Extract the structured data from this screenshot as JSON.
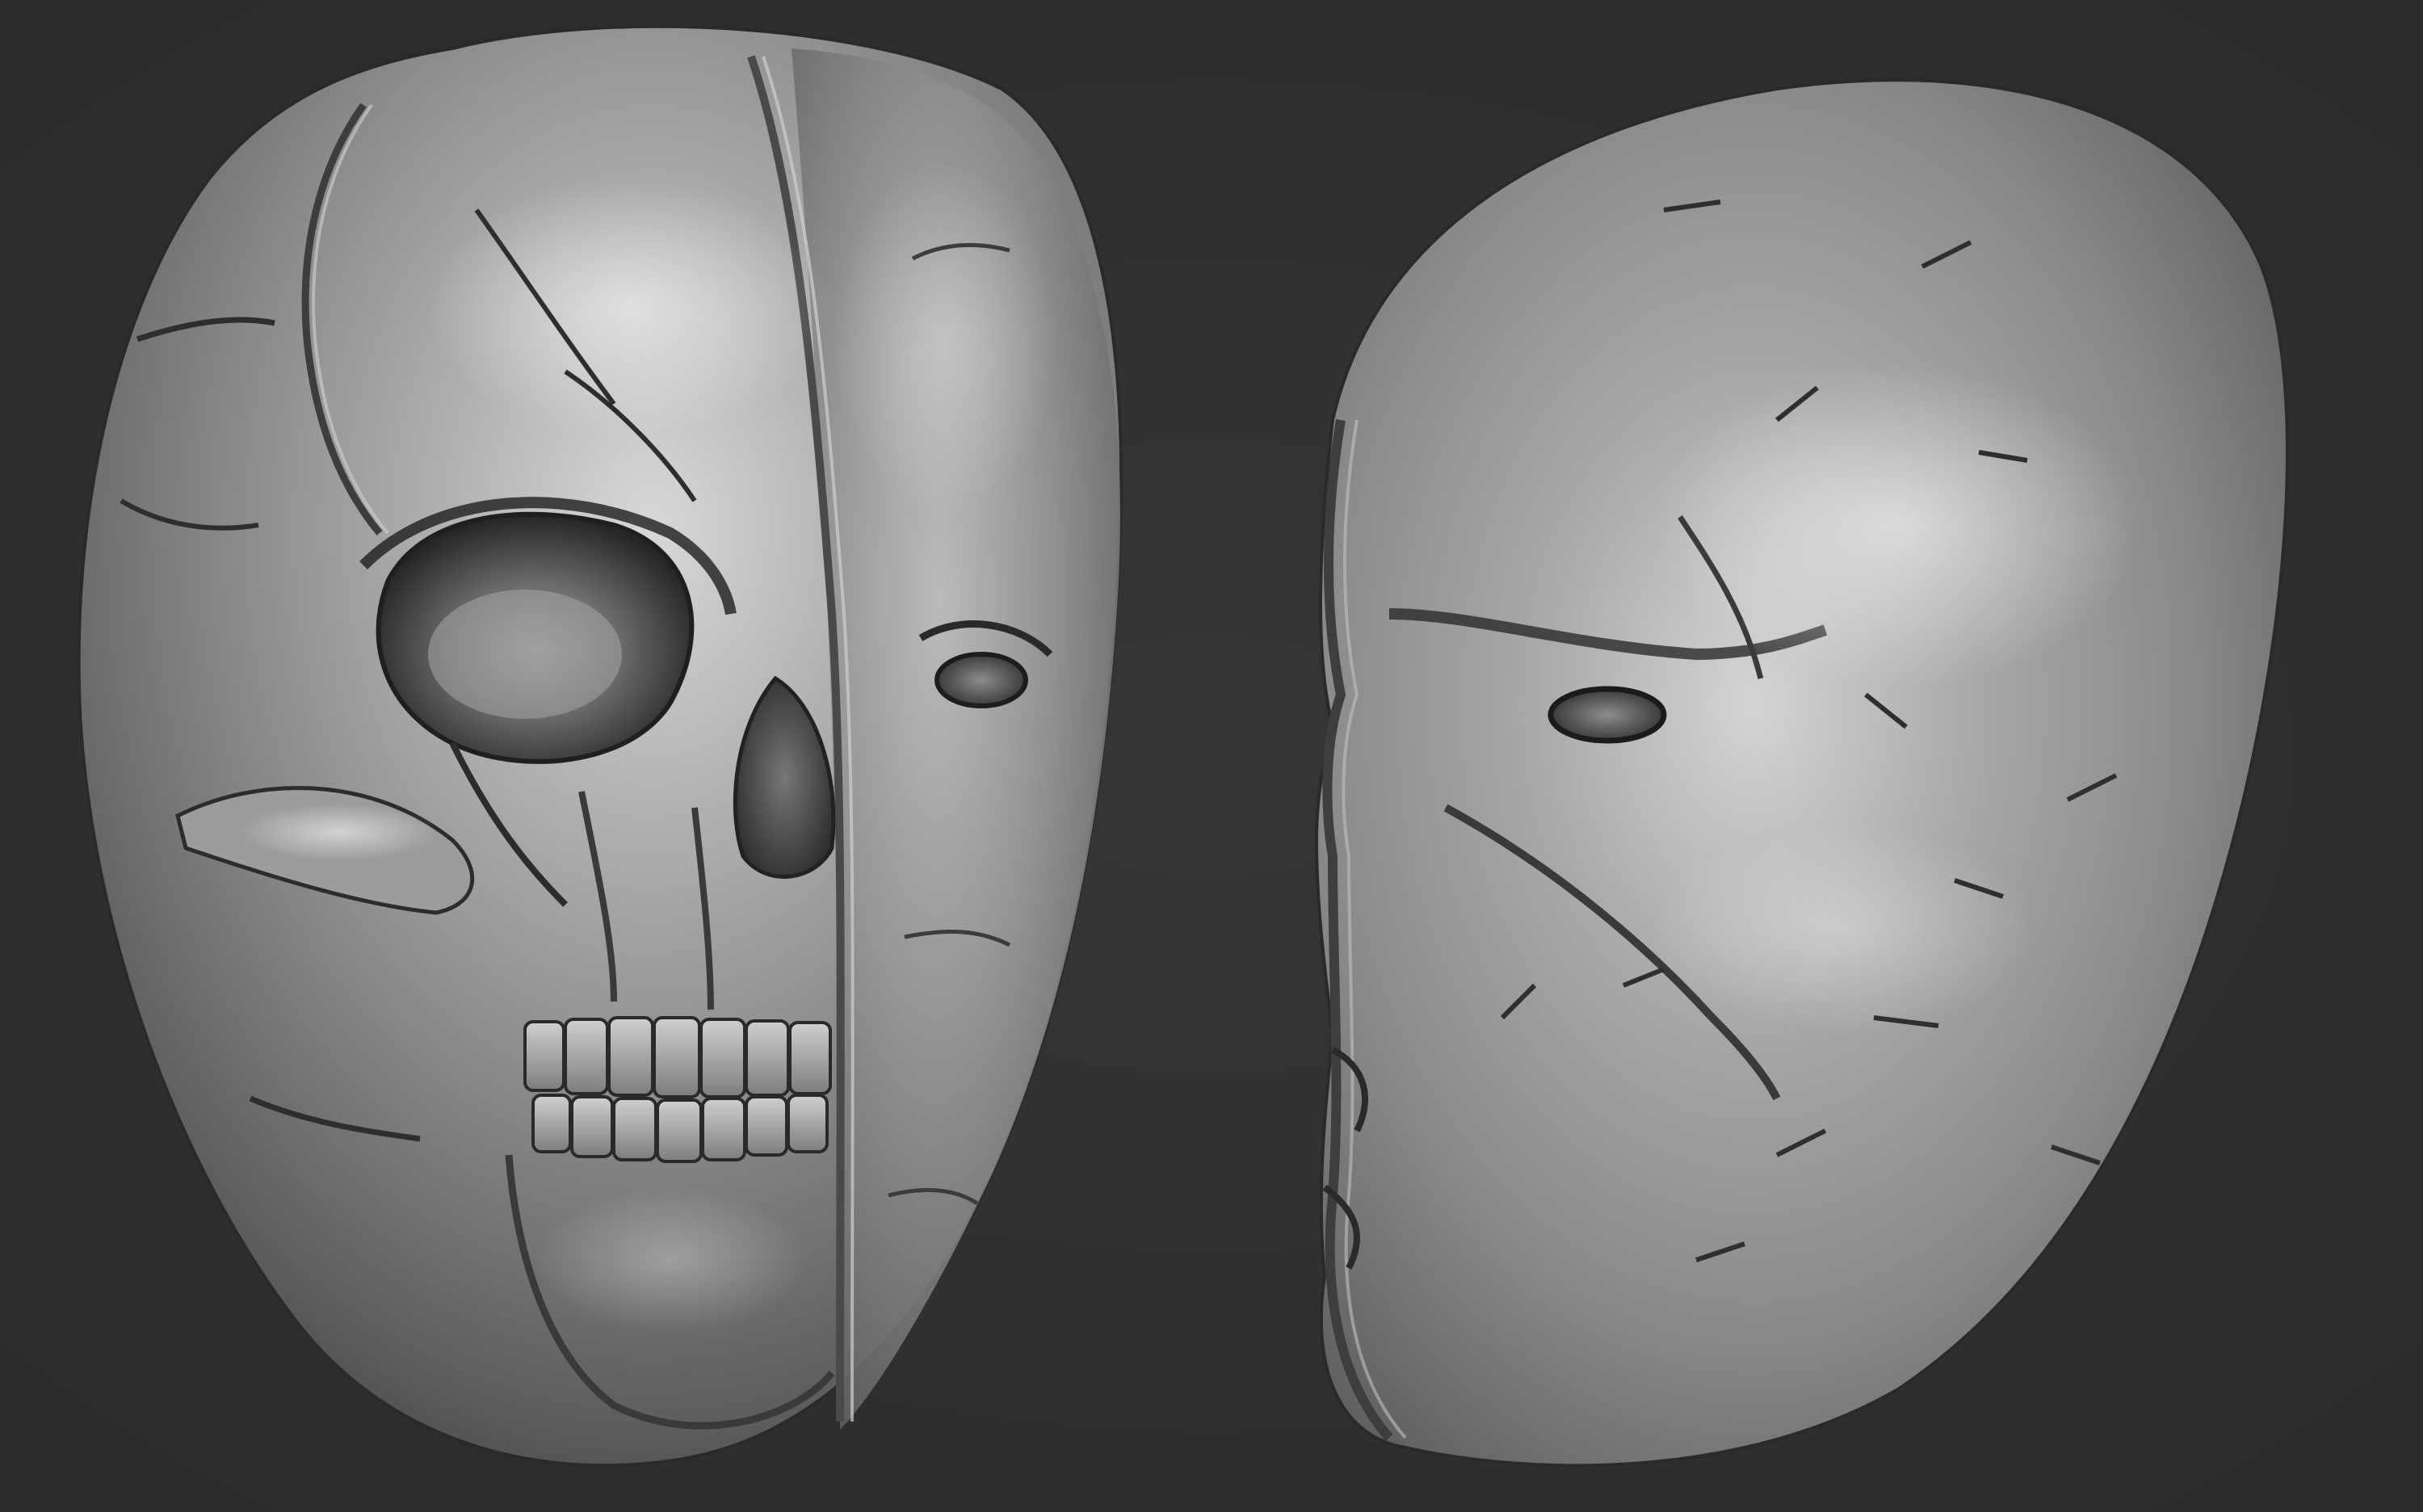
{
  "scene": {
    "background_color": "#2f2f30",
    "material_color": "#8a8a8a",
    "objects": [
      {
        "name": "skull-mask-front",
        "description_icon": "sculpt-mask-icon"
      },
      {
        "name": "mask-side",
        "description_icon": "sculpt-mask-icon"
      }
    ]
  }
}
